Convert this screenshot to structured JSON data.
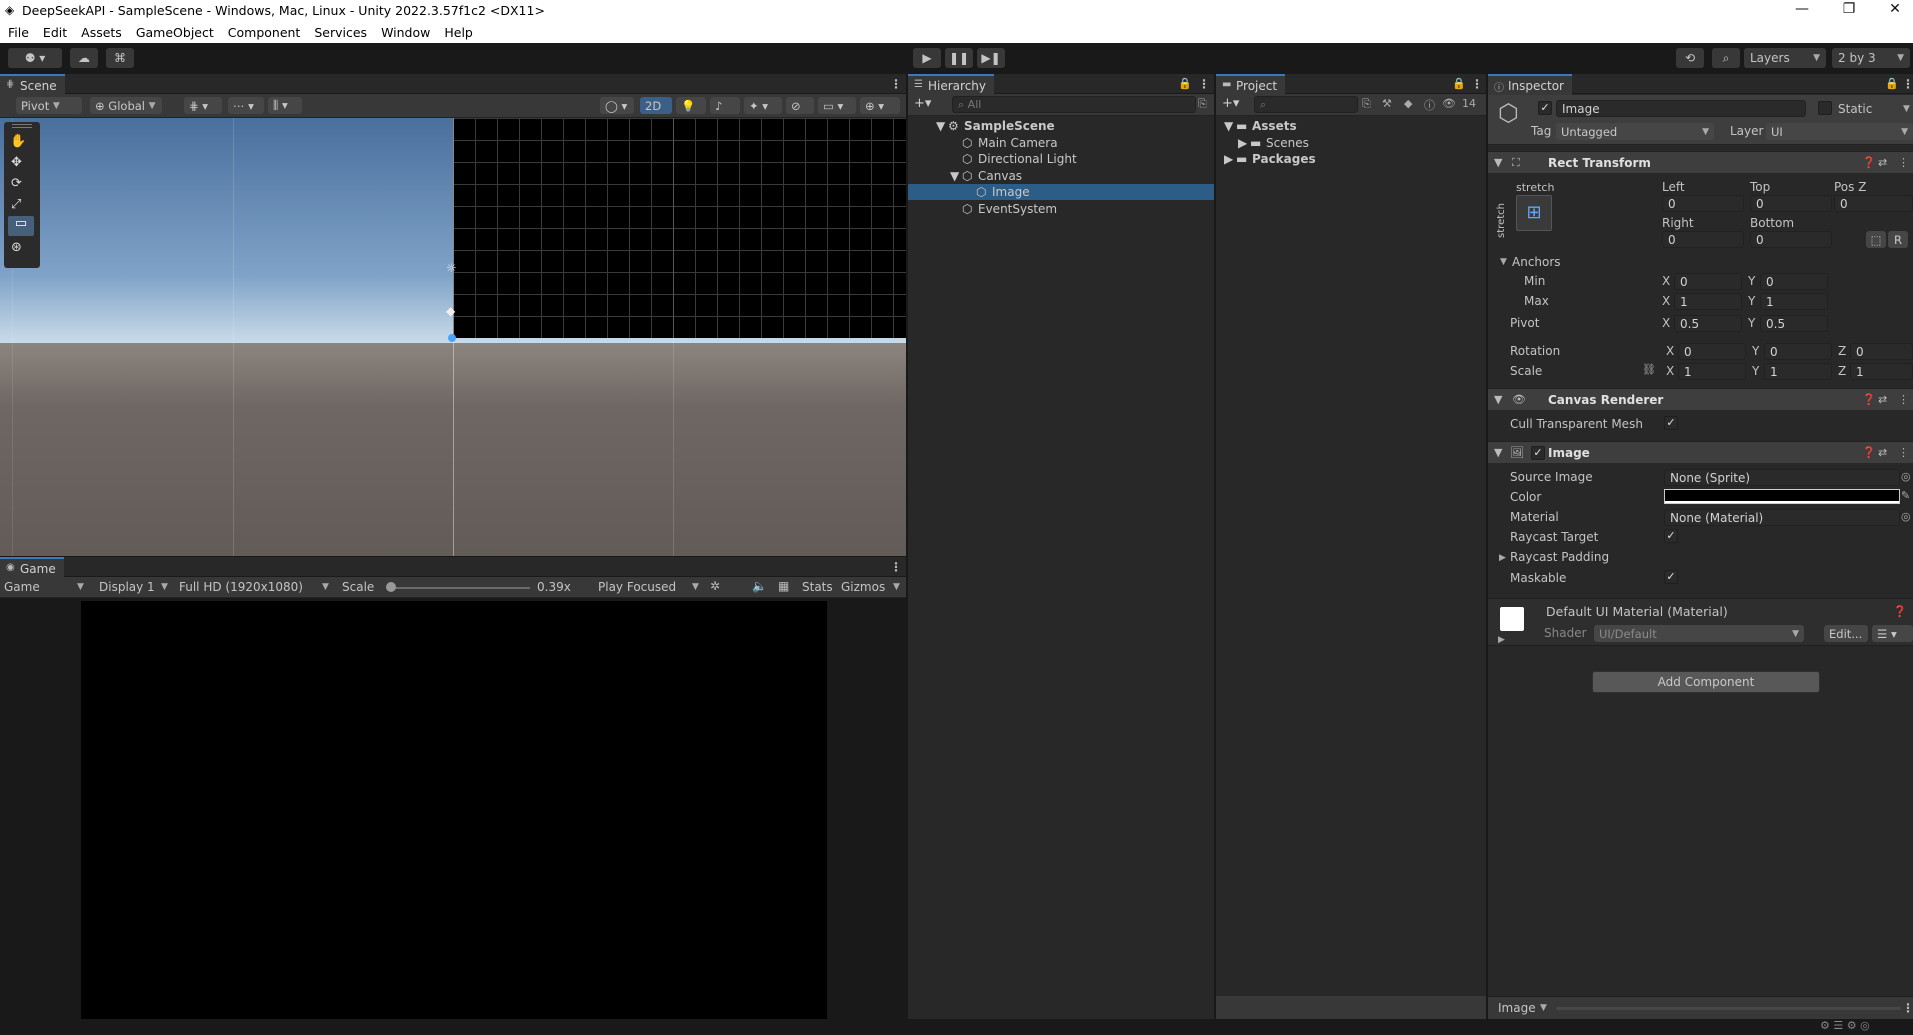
{
  "window": {
    "title": "DeepSeekAPI - SampleScene - Windows, Mac, Linux - Unity 2022.3.57f1c2 <DX11>",
    "min": "—",
    "max": "❐",
    "close": "✕"
  },
  "menu": [
    "File",
    "Edit",
    "Assets",
    "GameObject",
    "Component",
    "Services",
    "Window",
    "Help"
  ],
  "toolbar": {
    "layers": "Layers",
    "layout": "2 by 3"
  },
  "scene": {
    "tab": "Scene",
    "pivot": "Pivot",
    "global": "Global",
    "twod": "2D"
  },
  "game": {
    "tab": "Game",
    "view": "Game",
    "display": "Display 1",
    "resolution": "Full HD (1920x1080)",
    "scale_label": "Scale",
    "scale_value": "0.39x",
    "play_focused": "Play Focused",
    "stats": "Stats",
    "gizmos": "Gizmos",
    "scale_level": 0.0
  },
  "hierarchy": {
    "tab": "Hierarchy",
    "search_placeholder": "All",
    "items": [
      {
        "label": "SampleScene",
        "depth": 0
      },
      {
        "label": "Main Camera",
        "depth": 1
      },
      {
        "label": "Directional Light",
        "depth": 1
      },
      {
        "label": "Canvas",
        "depth": 1
      },
      {
        "label": "Image",
        "depth": 2
      },
      {
        "label": "EventSystem",
        "depth": 1
      }
    ]
  },
  "project": {
    "tab": "Project",
    "count": "14",
    "items": [
      {
        "label": "Assets",
        "depth": 0
      },
      {
        "label": "Scenes",
        "depth": 1
      },
      {
        "label": "Packages",
        "depth": 0
      }
    ]
  },
  "inspector": {
    "tab": "Inspector",
    "name": "Image",
    "static": "Static",
    "tag_label": "Tag",
    "tag": "Untagged",
    "layer_label": "Layer",
    "layer": "UI",
    "rect": {
      "title": "Rect Transform",
      "stretch": "stretch",
      "left_lbl": "Left",
      "top_lbl": "Top",
      "posz_lbl": "Pos Z",
      "left": "0",
      "top": "0",
      "posz": "0",
      "right_lbl": "Right",
      "bottom_lbl": "Bottom",
      "right": "0",
      "bottom": "0",
      "anchors": "Anchors",
      "min": "Min",
      "max": "Max",
      "min_x": "0",
      "min_y": "0",
      "max_x": "1",
      "max_y": "1",
      "pivot": "Pivot",
      "pivot_x": "0.5",
      "pivot_y": "0.5",
      "rotation": "Rotation",
      "rot_x": "0",
      "rot_y": "0",
      "rot_z": "0",
      "scale": "Scale",
      "scale_x": "1",
      "scale_y": "1",
      "scale_z": "1",
      "X": "X",
      "Y": "Y",
      "Z": "Z",
      "R": "R"
    },
    "canvas_renderer": {
      "title": "Canvas Renderer",
      "cull": "Cull Transparent Mesh"
    },
    "image": {
      "title": "Image",
      "source_image": "Source Image",
      "source_val": "None (Sprite)",
      "color": "Color",
      "material": "Material",
      "material_val": "None (Material)",
      "raycast_target": "Raycast Target",
      "raycast_padding": "Raycast Padding",
      "maskable": "Maskable",
      "color_hex": "#000000"
    },
    "material": {
      "name": "Default UI Material (Material)",
      "shader_lbl": "Shader",
      "shader": "UI/Default",
      "edit": "Edit..."
    },
    "add_component": "Add Component",
    "footer": "Image"
  }
}
